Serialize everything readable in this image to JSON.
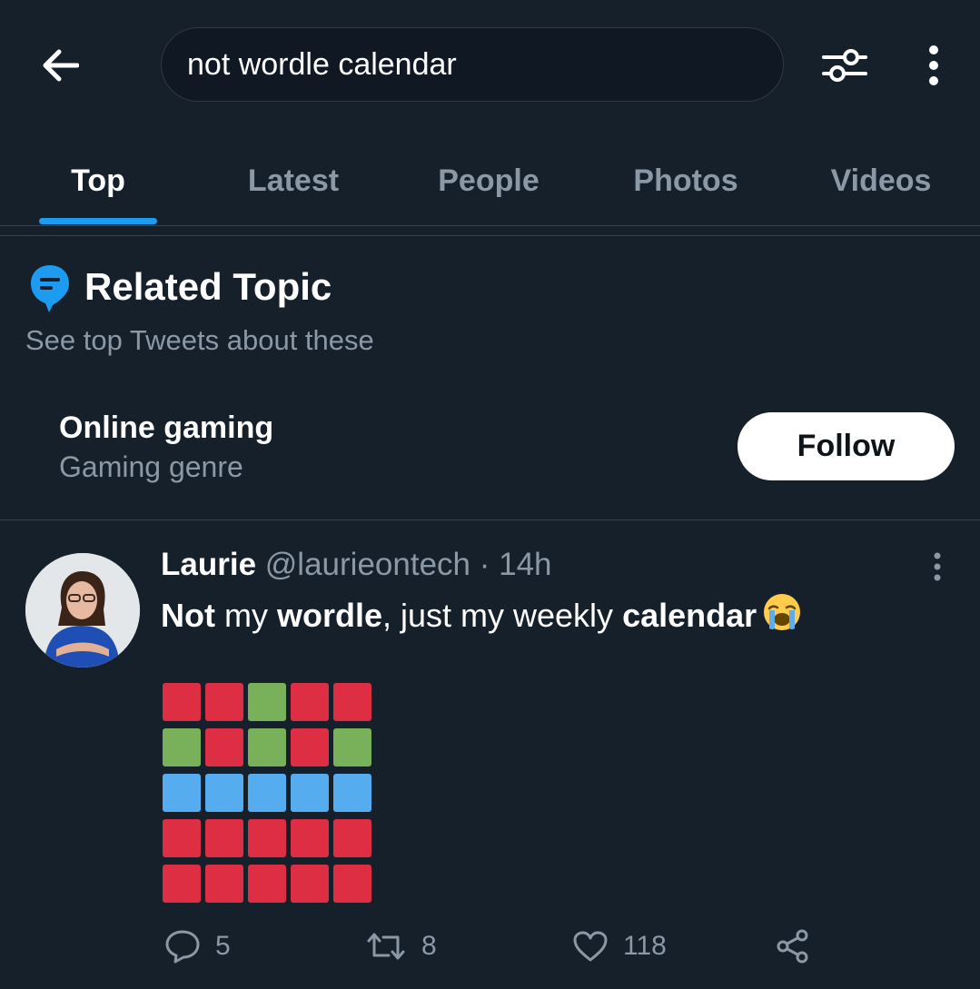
{
  "search": {
    "query": "not wordle calendar"
  },
  "tabs": [
    {
      "label": "Top",
      "active": true
    },
    {
      "label": "Latest"
    },
    {
      "label": "People"
    },
    {
      "label": "Photos"
    },
    {
      "label": "Videos"
    }
  ],
  "related_topic": {
    "title": "Related Topic",
    "subtitle": "See top Tweets about these",
    "topic_name": "Online gaming",
    "topic_category": "Gaming genre",
    "follow_label": "Follow"
  },
  "tweet": {
    "display_name": "Laurie",
    "handle": "@laurieontech",
    "separator": "·",
    "time": "14h",
    "text_parts": [
      "Not",
      " my ",
      "wordle",
      ", just my weekly ",
      "calendar"
    ],
    "emoji": "loudly-crying-face",
    "grid": [
      [
        "red",
        "red",
        "green",
        "red",
        "red"
      ],
      [
        "green",
        "red",
        "green",
        "red",
        "green"
      ],
      [
        "blue",
        "blue",
        "blue",
        "blue",
        "blue"
      ],
      [
        "red",
        "red",
        "red",
        "red",
        "red"
      ],
      [
        "red",
        "red",
        "red",
        "red",
        "red"
      ]
    ],
    "grid_colors": {
      "red": "#dd2e44",
      "green": "#78b159",
      "blue": "#55acee"
    },
    "actions": {
      "replies": "5",
      "retweets": "8",
      "likes": "118"
    }
  },
  "colors": {
    "background": "#15202b",
    "accent": "#1d9bf0",
    "secondary_text": "#8b98a5",
    "divider": "#38444d"
  },
  "icons": [
    "back-arrow-icon",
    "search-filter-icon",
    "more-vertical-icon",
    "topic-bubble-icon",
    "reply-icon",
    "retweet-icon",
    "like-icon",
    "share-icon"
  ]
}
